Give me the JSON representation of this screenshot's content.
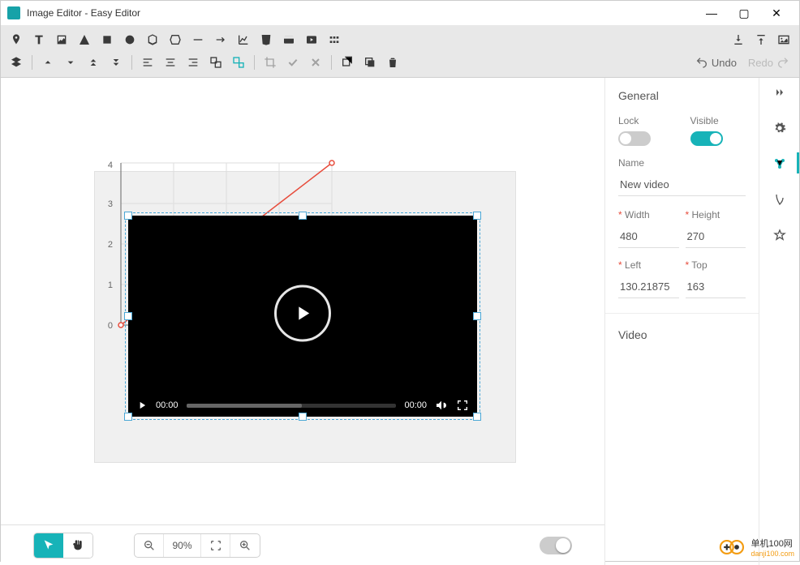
{
  "window": {
    "title": "Image Editor - Easy Editor"
  },
  "undo": {
    "label": "Undo"
  },
  "redo": {
    "label": "Redo"
  },
  "footer": {
    "zoom": "90%"
  },
  "panel": {
    "general_title": "General",
    "lock_label": "Lock",
    "visible_label": "Visible",
    "name_label": "Name",
    "name_value": "New video",
    "width_label": "Width",
    "height_label": "Height",
    "width_value": "480",
    "height_value": "270",
    "left_label": "Left",
    "top_label": "Top",
    "left_value": "130.21875",
    "top_value": "163",
    "video_title": "Video"
  },
  "video": {
    "time_current": "00:00",
    "time_total": "00:00"
  },
  "chart_data": {
    "type": "line",
    "x": [
      0,
      1,
      2,
      3,
      4
    ],
    "y": [
      0,
      1,
      2,
      3,
      4
    ],
    "xlim": [
      0,
      4
    ],
    "ylim": [
      0,
      4
    ],
    "yticks": [
      "0",
      "1",
      "2",
      "3",
      "4"
    ]
  },
  "watermark": {
    "brand": "单机100网",
    "url": "danji100.com"
  }
}
